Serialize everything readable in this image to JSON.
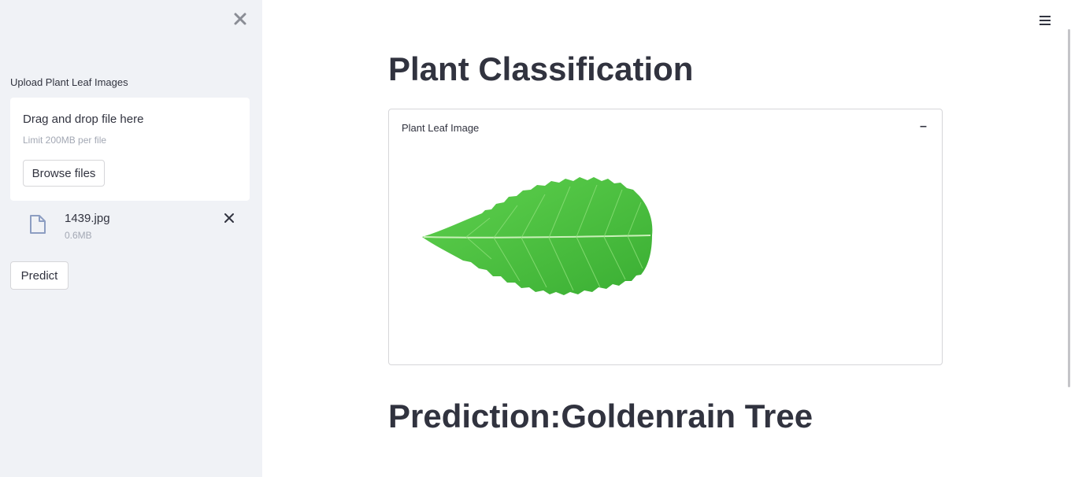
{
  "sidebar": {
    "upload_label": "Upload Plant Leaf Images",
    "dropzone": {
      "title": "Drag and drop file here",
      "limit": "Limit 200MB per file",
      "browse_label": "Browse files"
    },
    "file": {
      "name": "1439.jpg",
      "size": "0.6MB"
    },
    "predict_label": "Predict"
  },
  "main": {
    "title": "Plant Classification",
    "expander": {
      "label": "Plant Leaf Image",
      "toggle": "–"
    },
    "prediction": "Prediction:Goldenrain Tree"
  },
  "colors": {
    "sidebar_bg": "#f0f2f6",
    "text": "#31333f",
    "muted": "#a3a8b4",
    "leaf": "#4cc23f"
  }
}
